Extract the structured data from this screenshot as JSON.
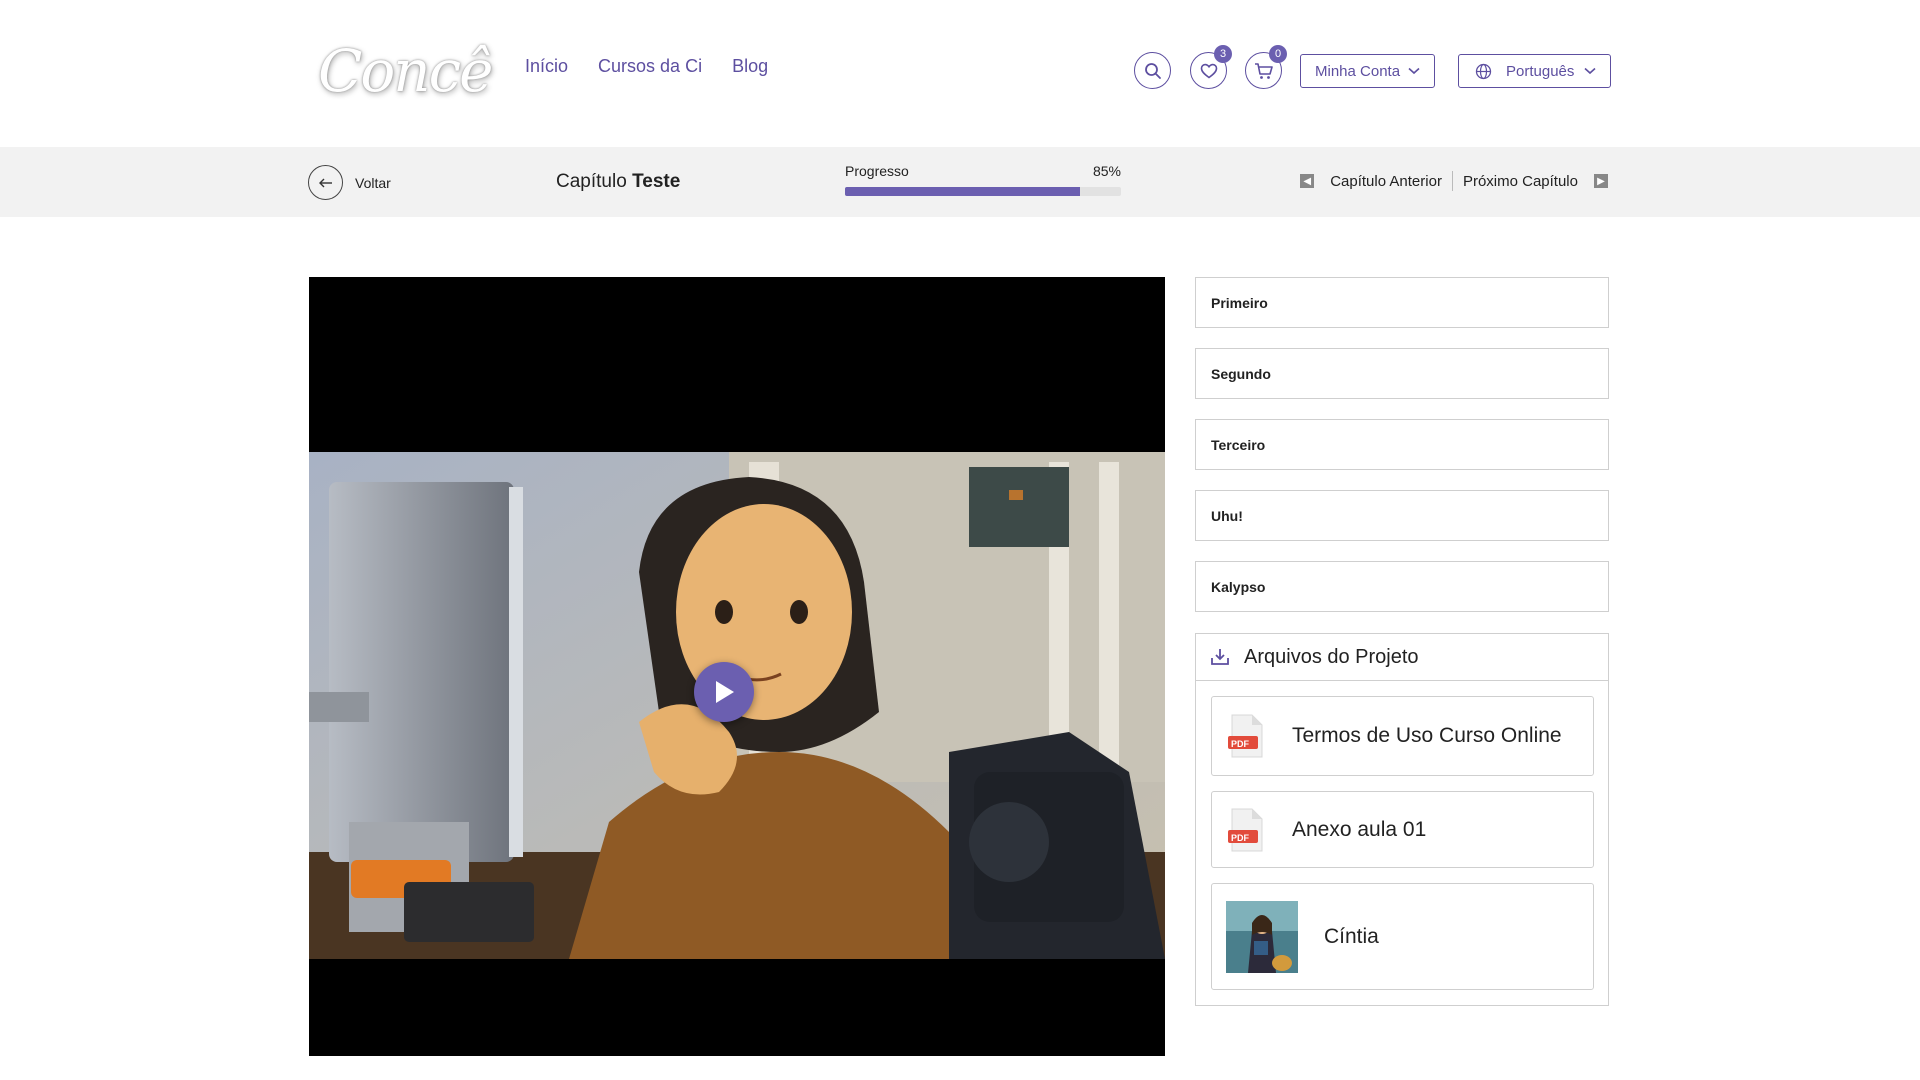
{
  "header": {
    "logo_text": "Concê",
    "nav": [
      "Início",
      "Cursos da Ci",
      "Blog"
    ],
    "wishlist_count": "3",
    "cart_count": "0",
    "account_label": "Minha Conta",
    "language_label": "Português"
  },
  "subbar": {
    "back_label": "Voltar",
    "chapter_prefix": "Capítulo",
    "chapter_name": "Teste",
    "progress_label": "Progresso",
    "progress_text": "85%",
    "progress_value": 0.85,
    "prev_label": "Capítulo Anterior",
    "next_label": "Próximo Capítulo"
  },
  "lessons": [
    "Primeiro",
    "Segundo",
    "Terceiro",
    "Uhu!",
    "Kalypso"
  ],
  "files": {
    "title": "Arquivos do Projeto",
    "pdf_badge": "PDF",
    "items": [
      {
        "name": "Termos de Uso Curso Online",
        "type": "pdf"
      },
      {
        "name": "Anexo aula 01",
        "type": "pdf"
      },
      {
        "name": "Cíntia",
        "type": "image"
      }
    ]
  },
  "icons": {
    "search": "search-icon",
    "wishlist": "heart-icon",
    "cart": "cart-icon",
    "account_chevron": "chevron-down-icon",
    "language": "globe-icon",
    "back": "arrow-left-icon",
    "play": "play-icon",
    "download": "download-icon"
  },
  "colors": {
    "accent": "#5d4fa0",
    "progress": "#6b5fb0",
    "pdf_red": "#e24b3b"
  }
}
